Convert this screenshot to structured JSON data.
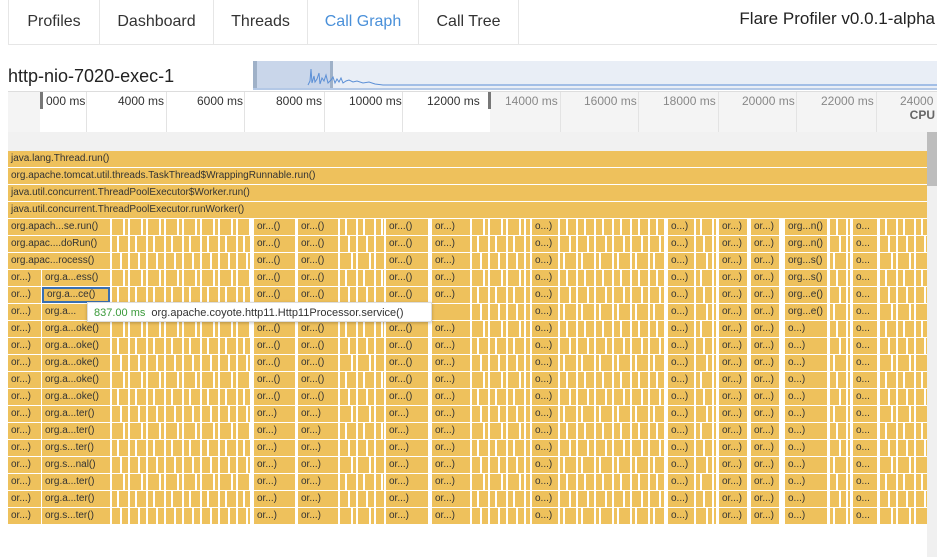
{
  "tabs": [
    {
      "label": "Profiles",
      "active": false
    },
    {
      "label": "Dashboard",
      "active": false
    },
    {
      "label": "Threads",
      "active": false
    },
    {
      "label": "Call Graph",
      "active": true
    },
    {
      "label": "Call Tree",
      "active": false
    }
  ],
  "app_title": "Flare Profiler v0.0.1-alpha",
  "thread_name": "http-nio-7020-exec-1",
  "axis": {
    "ticks": [
      "000 ms",
      "4000 ms",
      "6000 ms",
      "8000 ms",
      "10000 ms",
      "12000 ms",
      "14000 ms",
      "16000 ms",
      "18000 ms",
      "20000 ms",
      "22000 ms",
      "24000"
    ],
    "cpu_label": "CPU"
  },
  "full_rows": [
    "java.lang.Thread.run()",
    "org.apache.tomcat.util.threads.TaskThread$WrappingRunnable.run()",
    "java.util.concurrent.ThreadPoolExecutor$Worker.run()",
    "java.util.concurrent.ThreadPoolExecutor.runWorker()"
  ],
  "deep_rows": [
    {
      "c0": "org.apach...se.run()",
      "c1": "",
      "g1": "or...()",
      "g2": "or...()",
      "g3": "or...()",
      "g4": "or...)",
      "g5": "o...)",
      "g6": "o...)",
      "g7": "or...)",
      "g8": "or...)",
      "g9": "org...n()",
      "g10": "o..."
    },
    {
      "c0": "org.apac....doRun()",
      "c1": "",
      "g1": "or...()",
      "g2": "or...()",
      "g3": "or...()",
      "g4": "or...)",
      "g5": "o...)",
      "g6": "o...)",
      "g7": "or...)",
      "g8": "or...)",
      "g9": "org...n()",
      "g10": "o..."
    },
    {
      "c0": "org.apac...rocess()",
      "c1": "",
      "g1": "or...()",
      "g2": "or...()",
      "g3": "or...()",
      "g4": "or...)",
      "g5": "o...)",
      "g6": "o...)",
      "g7": "or...)",
      "g8": "or...)",
      "g9": "org...s()",
      "g10": "o..."
    },
    {
      "c0": "or...)",
      "c1": "org.a...ess()",
      "g1": "or...()",
      "g2": "or...()",
      "g3": "or...()",
      "g4": "or...)",
      "g5": "o...)",
      "g6": "o...)",
      "g7": "or...)",
      "g8": "or...)",
      "g9": "org...s()",
      "g10": "o..."
    },
    {
      "c0": "or...)",
      "c1": "org.a...ce()",
      "g1": "or...()",
      "g2": "or...()",
      "g3": "or...()",
      "g4": "or...)",
      "g5": "o...)",
      "g6": "o...)",
      "g7": "or...)",
      "g8": "or...)",
      "g9": "org...e()",
      "g10": "o..."
    },
    {
      "c0": "or...)",
      "c1": "org.a...",
      "g1": "",
      "g2": "",
      "g3": "",
      "g4": "",
      "g5": "o...)",
      "g6": "o...)",
      "g7": "or...)",
      "g8": "or...)",
      "g9": "org...e()",
      "g10": "o..."
    },
    {
      "c0": "or...)",
      "c1": "org.a...oke()",
      "g1": "or...()",
      "g2": "or...()",
      "g3": "or...()",
      "g4": "or...)",
      "g5": "o...)",
      "g6": "o...)",
      "g7": "or...)",
      "g8": "or...)",
      "g9": "o...)",
      "g10": "o..."
    },
    {
      "c0": "or...)",
      "c1": "org.a...oke()",
      "g1": "or...()",
      "g2": "or...()",
      "g3": "or...()",
      "g4": "or...)",
      "g5": "o...)",
      "g6": "o...)",
      "g7": "or...)",
      "g8": "or...)",
      "g9": "o...)",
      "g10": "o..."
    },
    {
      "c0": "or...)",
      "c1": "org.a...oke()",
      "g1": "or...()",
      "g2": "or...()",
      "g3": "or...()",
      "g4": "or...)",
      "g5": "o...)",
      "g6": "o...)",
      "g7": "or...)",
      "g8": "or...)",
      "g9": "o...)",
      "g10": "o..."
    },
    {
      "c0": "or...)",
      "c1": "org.a...oke()",
      "g1": "or...()",
      "g2": "or...()",
      "g3": "or...()",
      "g4": "or...)",
      "g5": "o...)",
      "g6": "o...)",
      "g7": "or...)",
      "g8": "or...)",
      "g9": "o...)",
      "g10": "o..."
    },
    {
      "c0": "or...)",
      "c1": "org.a...oke()",
      "g1": "or...()",
      "g2": "or...()",
      "g3": "or...()",
      "g4": "or...)",
      "g5": "o...)",
      "g6": "o...)",
      "g7": "or...)",
      "g8": "or...)",
      "g9": "o...)",
      "g10": "o..."
    },
    {
      "c0": "or...)",
      "c1": "org.a...ter()",
      "g1": "or...)",
      "g2": "or...)",
      "g3": "or...)",
      "g4": "or...)",
      "g5": "o...)",
      "g6": "o...)",
      "g7": "or...)",
      "g8": "or...)",
      "g9": "o...)",
      "g10": "o..."
    },
    {
      "c0": "or...)",
      "c1": "org.a...ter()",
      "g1": "or...)",
      "g2": "or...)",
      "g3": "or...)",
      "g4": "or...)",
      "g5": "o...)",
      "g6": "o...)",
      "g7": "or...)",
      "g8": "or...)",
      "g9": "o...)",
      "g10": "o..."
    },
    {
      "c0": "or...)",
      "c1": "org.s...ter()",
      "g1": "or...)",
      "g2": "or...)",
      "g3": "or...)",
      "g4": "or...)",
      "g5": "o...)",
      "g6": "o...)",
      "g7": "or...)",
      "g8": "or...)",
      "g9": "o...)",
      "g10": "o..."
    },
    {
      "c0": "or...)",
      "c1": "org.s...nal()",
      "g1": "or...)",
      "g2": "or...)",
      "g3": "or...)",
      "g4": "or...)",
      "g5": "o...)",
      "g6": "o...)",
      "g7": "or...)",
      "g8": "or...)",
      "g9": "o...)",
      "g10": "o..."
    },
    {
      "c0": "or...)",
      "c1": "org.a...ter()",
      "g1": "or...)",
      "g2": "or...)",
      "g3": "or...)",
      "g4": "or...)",
      "g5": "o...)",
      "g6": "o...)",
      "g7": "or...)",
      "g8": "or...)",
      "g9": "o...)",
      "g10": "o..."
    },
    {
      "c0": "or...)",
      "c1": "org.a...ter()",
      "g1": "or...)",
      "g2": "or...)",
      "g3": "or...)",
      "g4": "or...)",
      "g5": "o...)",
      "g6": "o...)",
      "g7": "or...)",
      "g8": "or...)",
      "g9": "o...)",
      "g10": "o..."
    },
    {
      "c0": "or...)",
      "c1": "org.s...ter()",
      "g1": "or...)",
      "g2": "or...)",
      "g3": "or...)",
      "g4": "or...)",
      "g5": "o...)",
      "g6": "o...)",
      "g7": "or...)",
      "g8": "or...)",
      "g9": "o...)",
      "g10": "o..."
    }
  ],
  "tooltip": {
    "time": "837.00 ms",
    "method": "org.apache.coyote.http11.Http11Processor.service()"
  },
  "colors": {
    "frame": "#eec15c",
    "accent": "#4a90d9",
    "selected_border": "#3a6fb0"
  }
}
